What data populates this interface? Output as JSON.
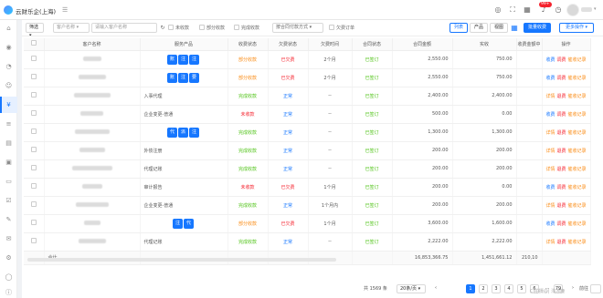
{
  "app": {
    "title": "云财乐企(上海)"
  },
  "header": {
    "badge": "99+",
    "collapse_icon": "fold-icon"
  },
  "toolbar": {
    "filter_label": "筛选",
    "customer_name_label": "客户名称",
    "search_placeholder": "请输入客户名称",
    "checkboxes": [
      "未收款",
      "部分收款",
      "完成收款"
    ],
    "contract_select": "按合同付款方式",
    "arrears_label": "欠费订单",
    "buttons": {
      "list": "列表",
      "product": "产品",
      "view": "视图",
      "batch_charge": "批量收费",
      "more": "更多操作"
    }
  },
  "table": {
    "headers": [
      "客户名称",
      "服务产品",
      "收费状态",
      "欠费状态",
      "欠费时间",
      "合同状态",
      "合同金额",
      "实收",
      "收费金额中",
      "操作"
    ],
    "rows": [
      {
        "tags": [
          "账",
          "注",
          "注"
        ],
        "service": "",
        "charge_status": "部分收款",
        "arrears_status": "已欠费",
        "arrears_time": "2个月",
        "contract_status": "已签订",
        "amount": "2,550.00",
        "received": "750.00",
        "ops": [
          "收费",
          "调费",
          "催收记录"
        ]
      },
      {
        "tags": [
          "账",
          "注",
          "要"
        ],
        "service": "",
        "charge_status": "部分收款",
        "arrears_status": "已欠费",
        "arrears_time": "2个月",
        "contract_status": "已签订",
        "amount": "2,550.00",
        "received": "750.00",
        "ops": [
          "收费",
          "调费",
          "催收记录"
        ]
      },
      {
        "tags": [],
        "service": "入事代理",
        "charge_status": "完成收款",
        "arrears_status": "正常",
        "arrears_time": "--",
        "contract_status": "已签订",
        "amount": "2,400.00",
        "received": "2,400.00",
        "ops": [
          "详情",
          "退费",
          "催收记录"
        ]
      },
      {
        "tags": [],
        "service": "企业变更-普通",
        "charge_status": "未收款",
        "arrears_status": "正常",
        "arrears_time": "--",
        "contract_status": "已签订",
        "amount": "500.00",
        "received": "0.00",
        "ops": [
          "收费",
          "调费",
          "催收记录"
        ]
      },
      {
        "tags": [
          "代",
          "派",
          "注"
        ],
        "service": "",
        "charge_status": "完成收款",
        "arrears_status": "正常",
        "arrears_time": "--",
        "contract_status": "已签订",
        "amount": "1,300.00",
        "received": "1,300.00",
        "ops": [
          "详情",
          "退费",
          "催收记录"
        ]
      },
      {
        "tags": [],
        "service": "外债注册",
        "charge_status": "完成收款",
        "arrears_status": "正常",
        "arrears_time": "--",
        "contract_status": "已签订",
        "amount": "200.00",
        "received": "200.00",
        "ops": [
          "详情",
          "退费",
          "催收记录"
        ]
      },
      {
        "tags": [],
        "service": "代理记账",
        "charge_status": "完成收款",
        "arrears_status": "正常",
        "arrears_time": "--",
        "contract_status": "已签订",
        "amount": "200.00",
        "received": "200.00",
        "ops": [
          "详情",
          "退费",
          "催收记录"
        ]
      },
      {
        "tags": [],
        "service": "审计报告",
        "charge_status": "未收款",
        "arrears_status": "已欠费",
        "arrears_time": "1个月",
        "contract_status": "已签订",
        "amount": "200.00",
        "received": "0.00",
        "ops": [
          "收费",
          "调费",
          "催收记录"
        ]
      },
      {
        "tags": [],
        "service": "企业变更-普通",
        "charge_status": "完成收款",
        "arrears_status": "正常",
        "arrears_time": "1个月内",
        "contract_status": "已签订",
        "amount": "200.00",
        "received": "200.00",
        "ops": [
          "详情",
          "退费",
          "催收记录"
        ]
      },
      {
        "tags": [
          "注",
          "代"
        ],
        "service": "",
        "charge_status": "部分收款",
        "arrears_status": "已欠费",
        "arrears_time": "1个月",
        "contract_status": "已签订",
        "amount": "3,600.00",
        "received": "1,600.00",
        "ops": [
          "收费",
          "调费",
          "催收记录"
        ]
      },
      {
        "tags": [],
        "service": "代理记账",
        "charge_status": "完成收款",
        "arrears_status": "正常",
        "arrears_time": "--",
        "contract_status": "已签订",
        "amount": "2,222.00",
        "received": "2,222.00",
        "ops": [
          "详情",
          "退费",
          "催收记录"
        ]
      }
    ],
    "summary": {
      "label": "合计",
      "amount": "16,853,366.75",
      "received": "1,451,661.12",
      "partial": "210,10"
    }
  },
  "pagination": {
    "total": "共 1569 条",
    "page_size": "20条/页",
    "pages": [
      "1",
      "2",
      "3",
      "4",
      "5",
      "6",
      "...",
      "79"
    ],
    "goto": "前往",
    "page_unit": "页"
  },
  "watermark": "Ci拍摄@| 浅凉鹿",
  "colors": {
    "accent": "#1677ff",
    "red": "#f5222d",
    "green": "#52c41a",
    "orange": "#fa8c16"
  }
}
